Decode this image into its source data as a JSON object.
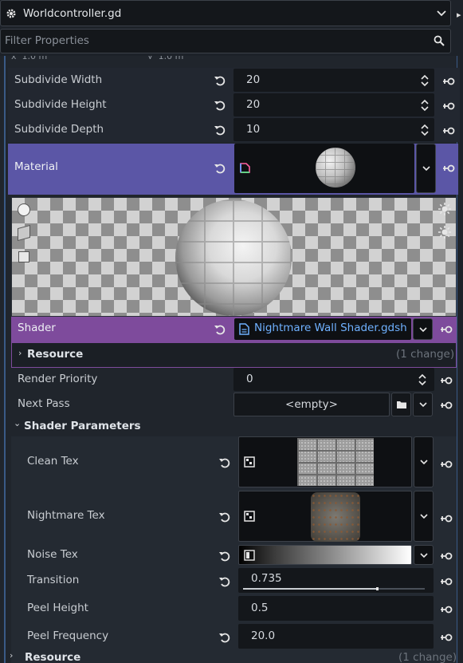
{
  "header": {
    "title": "Worldcontroller.gd"
  },
  "filter": {
    "placeholder": "Filter Properties"
  },
  "subdivide": [
    {
      "label": "Subdivide Width",
      "value": "20"
    },
    {
      "label": "Subdivide Height",
      "value": "20"
    },
    {
      "label": "Subdivide Depth",
      "value": "10"
    }
  ],
  "material": {
    "label": "Material"
  },
  "shader": {
    "label": "Shader",
    "value": "Nightmare Wall Shader.gdsh"
  },
  "resource_inner": {
    "label": "Resource",
    "changes": "(1 change)"
  },
  "render_priority": {
    "label": "Render Priority",
    "value": "0"
  },
  "next_pass": {
    "label": "Next Pass",
    "value": "<empty>"
  },
  "shader_params": {
    "title": "Shader Parameters",
    "clean_tex": {
      "label": "Clean Tex"
    },
    "nightmare_tex": {
      "label": "Nightmare Tex"
    },
    "noise_tex": {
      "label": "Noise Tex"
    },
    "transition": {
      "label": "Transition",
      "value": "0.735",
      "level": 0.735
    },
    "peel_height": {
      "label": "Peel Height",
      "value": "0.5"
    },
    "peel_frequency": {
      "label": "Peel Frequency",
      "value": "20.0"
    }
  },
  "resource_outer": {
    "label": "Resource",
    "changes": "(1 change)"
  },
  "colors": {
    "material_highlight": "#5b56a6",
    "shader_highlight": "#7e4b9c",
    "link_blue": "#6fb1ff"
  },
  "icons": [
    "gear-icon",
    "chevron-down-icon",
    "search-icon",
    "revert-icon",
    "pin-icon",
    "spin-arrows-icon",
    "folder-icon",
    "file-icon",
    "texture-icon",
    "gradient-icon"
  ]
}
